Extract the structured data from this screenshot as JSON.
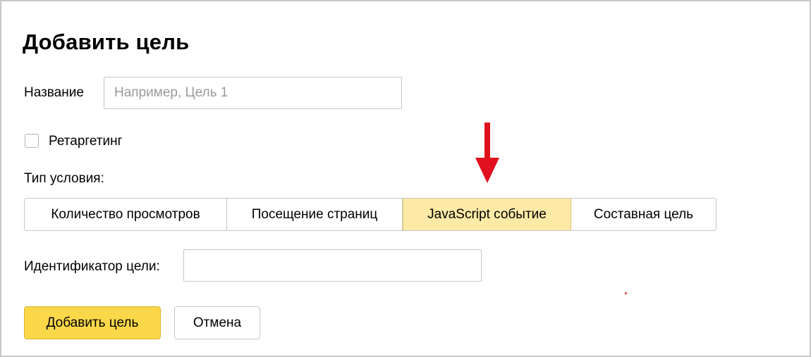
{
  "dialog": {
    "title": "Добавить цель",
    "name_field": {
      "label": "Название",
      "placeholder": "Например, Цель 1",
      "value": ""
    },
    "retargeting": {
      "label": "Ретаргетинг",
      "checked": false
    },
    "condition_type": {
      "label": "Тип условия:",
      "options": [
        "Количество просмотров",
        "Посещение страниц",
        "JavaScript событие",
        "Составная цель"
      ],
      "selected": "JavaScript событие"
    },
    "goal_id_field": {
      "label": "Идентификатор цели:",
      "value": ""
    },
    "buttons": {
      "add_label": "Добавить цель",
      "cancel_label": "Отмена"
    }
  },
  "annotation": {
    "arrow_icon": "arrow-down-icon",
    "arrow_color": "#e0101e"
  },
  "colors": {
    "accent_yellow": "#fbd84a",
    "selected_segment": "#fdeaa6",
    "border": "#c6c6c6"
  }
}
